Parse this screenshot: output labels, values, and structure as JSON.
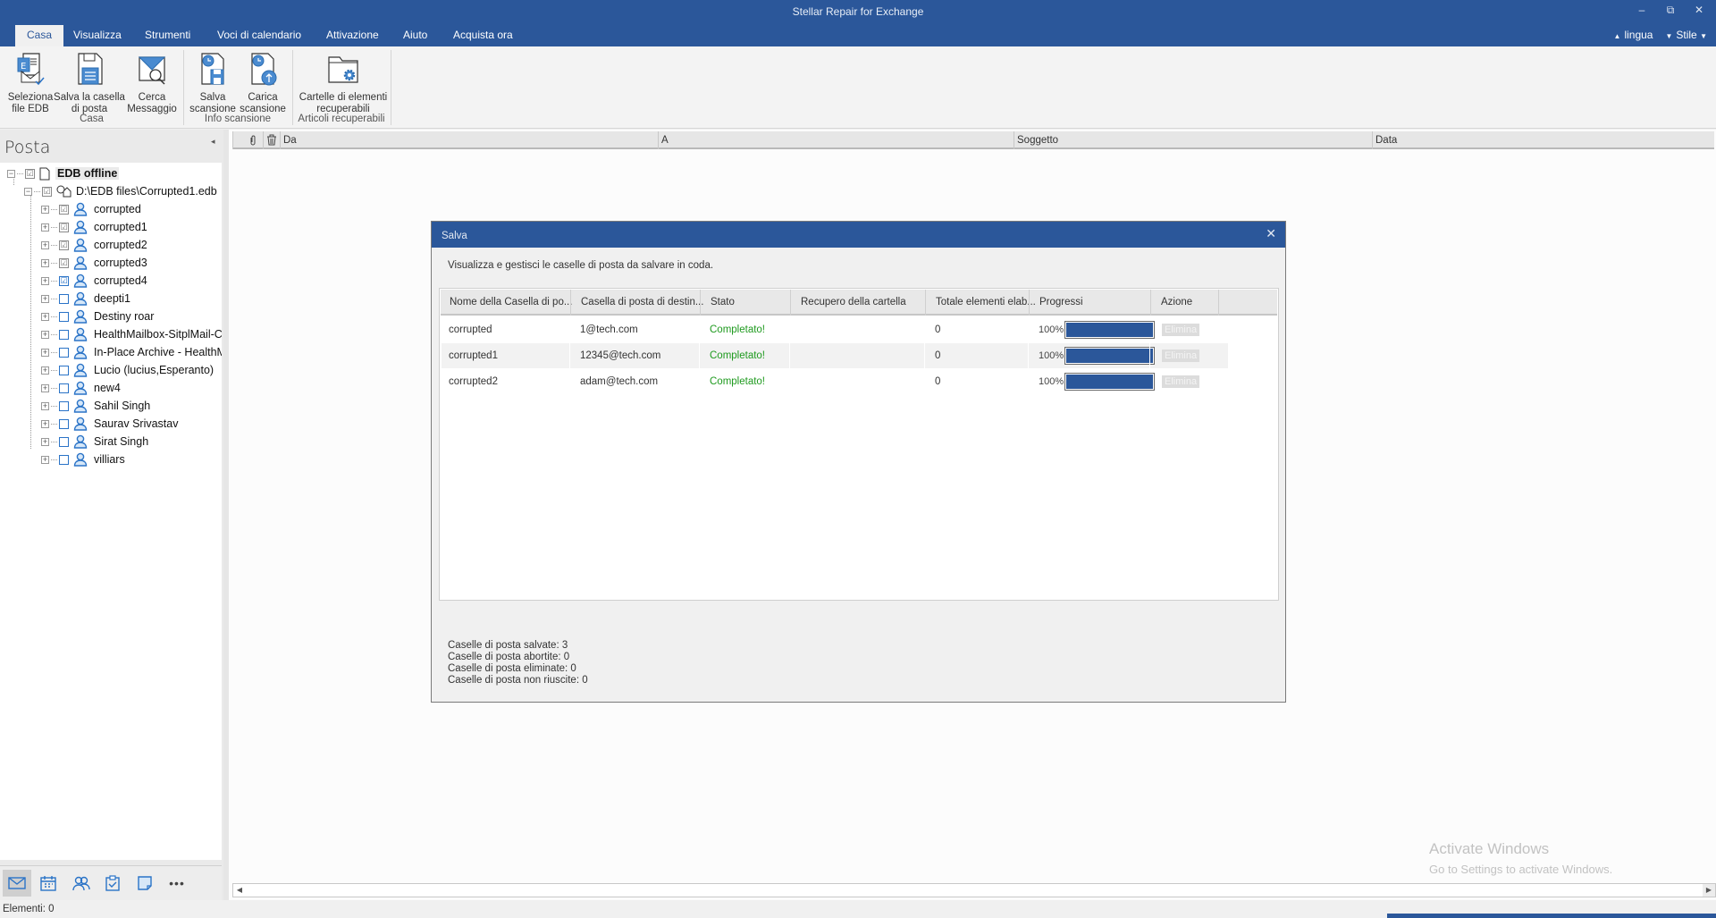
{
  "window": {
    "title": "Stellar Repair for Exchange",
    "controls": {
      "minimize": "–",
      "restore": "⧉",
      "close": "✕"
    }
  },
  "tabs": [
    {
      "label": "Casa",
      "active": true
    },
    {
      "label": "Visualizza"
    },
    {
      "label": "Strumenti"
    },
    {
      "label": "Voci di calendario"
    },
    {
      "label": "Attivazione"
    },
    {
      "label": "Aiuto"
    },
    {
      "label": "Acquista ora"
    }
  ],
  "tabbar_right": {
    "collapse_icon": "▲",
    "language": "lingua",
    "style": "Stile",
    "caret": "▼"
  },
  "ribbon": {
    "buttons": [
      {
        "label1": "Seleziona",
        "label2": "file EDB",
        "icon": "select-edb-icon"
      },
      {
        "label1": "Salva la casella",
        "label2": "di posta",
        "icon": "save-mailbox-icon"
      },
      {
        "label1": "Cerca",
        "label2": "Messaggio",
        "icon": "find-message-icon"
      },
      {
        "label1": "Salva",
        "label2": "scansione",
        "icon": "save-scan-icon"
      },
      {
        "label1": "Carica",
        "label2": "scansione",
        "icon": "load-scan-icon"
      },
      {
        "label1": "Cartelle di elementi",
        "label2": "recuperabili",
        "icon": "recoverable-folders-icon"
      }
    ],
    "groups": [
      "Casa",
      "Info scansione",
      "Articoli recuperabili"
    ]
  },
  "left_panel": {
    "title": "Posta",
    "collapse_icon": "◂",
    "root": {
      "label": "EDB offline",
      "checked": "partial"
    },
    "file": {
      "label": "D:\\EDB files\\Corrupted1.edb",
      "checked": "partial"
    },
    "mailboxes": [
      {
        "label": "corrupted",
        "checked": "partial"
      },
      {
        "label": "corrupted1",
        "checked": "partial"
      },
      {
        "label": "corrupted2",
        "checked": "partial"
      },
      {
        "label": "corrupted3",
        "checked": "partial"
      },
      {
        "label": "corrupted4",
        "checked": "checked"
      },
      {
        "label": "deepti1",
        "checked": "unchecked"
      },
      {
        "label": "Destiny roar",
        "checked": "unchecked"
      },
      {
        "label": "HealthMailbox-SitplMail-Cor",
        "checked": "unchecked"
      },
      {
        "label": "In-Place Archive - HealthMai",
        "checked": "unchecked"
      },
      {
        "label": "Lucio (lucius,Esperanto)",
        "checked": "unchecked"
      },
      {
        "label": "new4",
        "checked": "unchecked"
      },
      {
        "label": "Sahil Singh",
        "checked": "unchecked"
      },
      {
        "label": "Saurav Srivastav",
        "checked": "unchecked"
      },
      {
        "label": "Sirat Singh",
        "checked": "unchecked"
      },
      {
        "label": "villiars",
        "checked": "unchecked"
      }
    ],
    "nav": [
      "mail-icon",
      "calendar-icon",
      "contacts-icon",
      "tasks-icon",
      "notes-icon",
      "more-icon"
    ],
    "more_label": "•••"
  },
  "message_list": {
    "columns": [
      "Da",
      "A",
      "Soggetto",
      "Data"
    ],
    "attach_icon": "paperclip-icon",
    "delete_icon": "trash-icon"
  },
  "dialog": {
    "title": "Salva",
    "close": "✕",
    "description": "Visualizza e gestisci le caselle di posta da salvare in coda.",
    "columns": [
      "Nome della Casella di po...",
      "Casella di posta di destin...",
      "Stato",
      "Recupero della cartella",
      "Totale elementi elab...",
      "Progressi",
      "Azione"
    ],
    "rows": [
      {
        "name": "corrupted",
        "target": "1@tech.com",
        "status": "Completato!",
        "folder_recovery": "",
        "total": "0",
        "progress_label": "100%",
        "progress": 1.0,
        "action": "Elimina"
      },
      {
        "name": "corrupted1",
        "target": "12345@tech.com",
        "status": "Completato!",
        "folder_recovery": "",
        "total": "0",
        "progress_label": "100%",
        "progress": 1.0,
        "action": "Elimina"
      },
      {
        "name": "corrupted2",
        "target": "adam@tech.com",
        "status": "Completato!",
        "folder_recovery": "",
        "total": "0",
        "progress_label": "100%",
        "progress": 1.0,
        "action": "Elimina"
      }
    ],
    "summary": [
      "Caselle di posta salvate: 3",
      "Caselle di posta abortite: 0",
      "Caselle di posta eliminate: 0",
      "Caselle di posta non riuscite: 0"
    ]
  },
  "watermark": {
    "line1": "Activate Windows",
    "line2": "Go to Settings to activate Windows."
  },
  "status_bar": {
    "text": "Elementi: 0"
  },
  "colors": {
    "accent": "#2b579a",
    "success": "#1e9a1e"
  }
}
